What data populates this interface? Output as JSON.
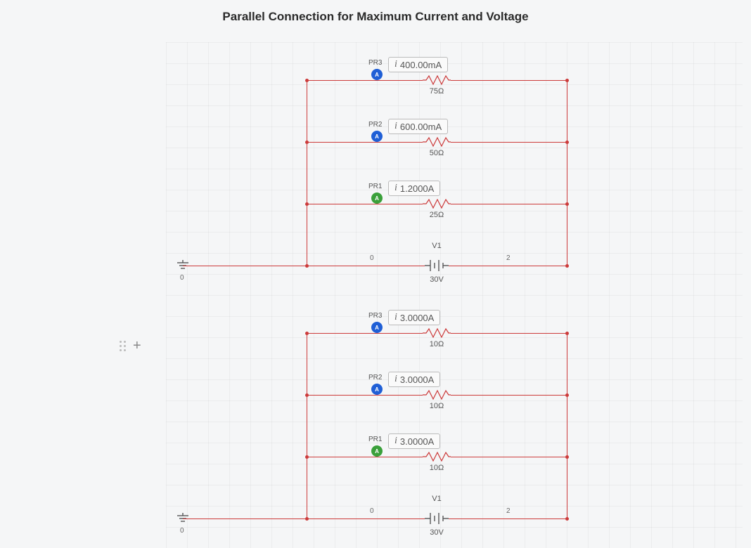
{
  "title": "Parallel Connection for Maximum Current and Voltage",
  "circuits": [
    {
      "branches": [
        {
          "probe": "PR3",
          "color": "blue",
          "reading": "400.00mA",
          "r": "75Ω"
        },
        {
          "probe": "PR2",
          "color": "blue",
          "reading": "600.00mA",
          "r": "50Ω"
        },
        {
          "probe": "PR1",
          "color": "green",
          "reading": "1.2000A",
          "r": "25Ω"
        }
      ],
      "source": {
        "name": "V1",
        "value": "30V",
        "left_node": "0",
        "right_node": "2"
      },
      "gnd_label": "0"
    },
    {
      "branches": [
        {
          "probe": "PR3",
          "color": "blue",
          "reading": "3.0000A",
          "r": "10Ω"
        },
        {
          "probe": "PR2",
          "color": "blue",
          "reading": "3.0000A",
          "r": "10Ω"
        },
        {
          "probe": "PR1",
          "color": "green",
          "reading": "3.0000A",
          "r": "10Ω"
        }
      ],
      "source": {
        "name": "V1",
        "value": "30V",
        "left_node": "0",
        "right_node": "2"
      },
      "gnd_label": "0"
    }
  ]
}
